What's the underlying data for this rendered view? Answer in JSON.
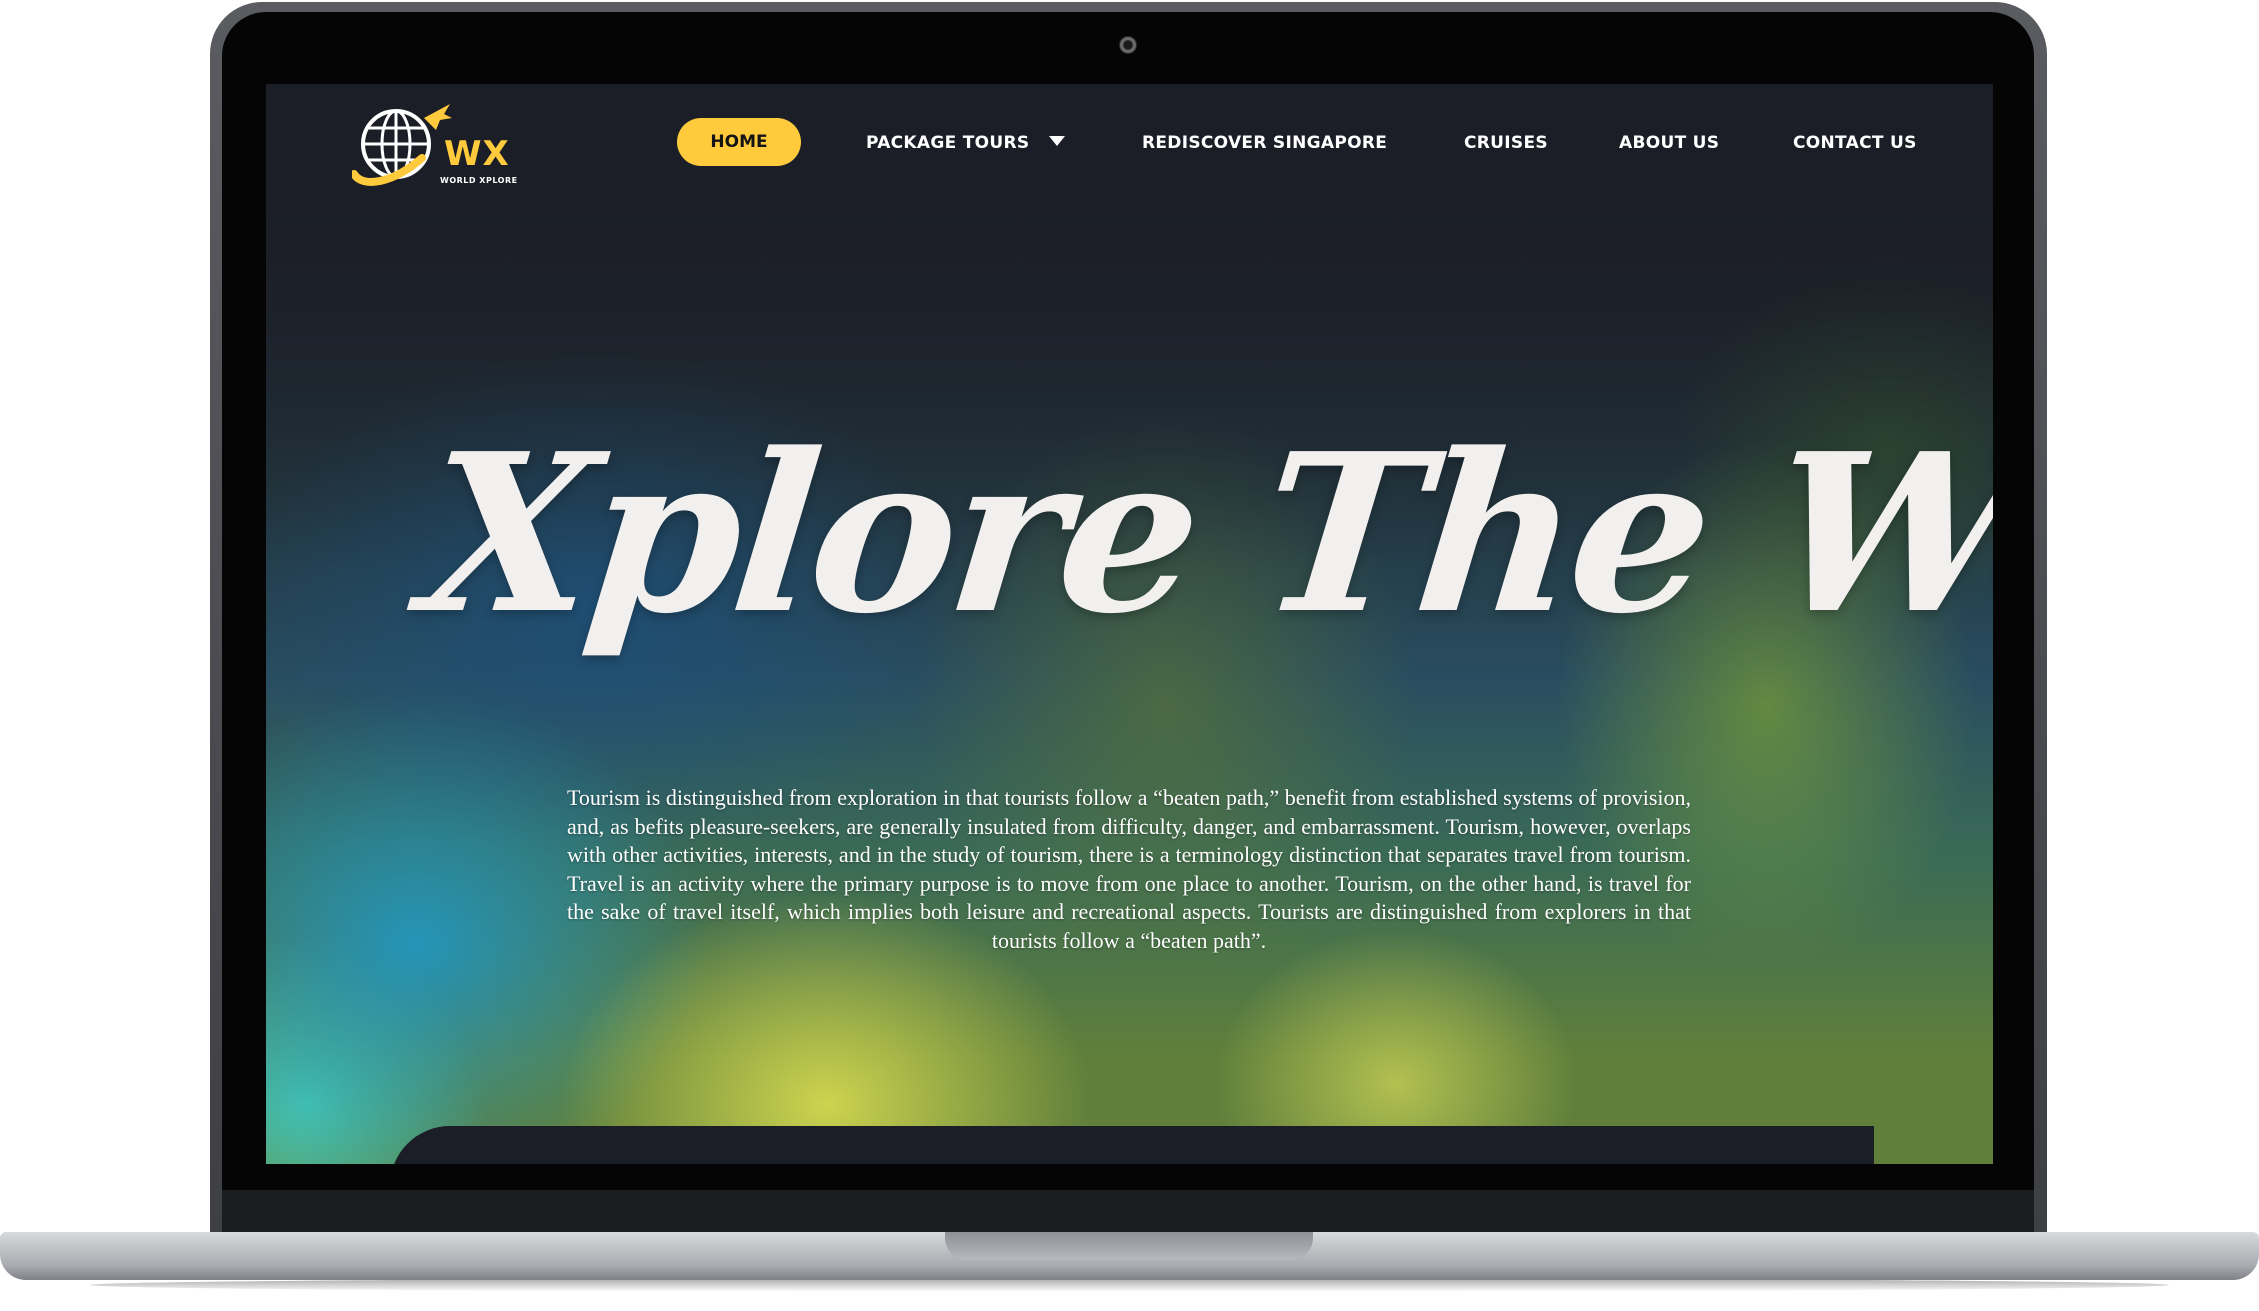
{
  "brand": {
    "logo_text": "WX",
    "logo_subtext": "WORLD XPLORE",
    "accent_color": "#ffcb3c"
  },
  "nav": {
    "home": "HOME",
    "package_tours": "PACKAGE TOURS",
    "rediscover_singapore": "REDISCOVER SINGAPORE",
    "cruises": "CRUISES",
    "about_us": "ABOUT US",
    "contact_us": "CONTACT US"
  },
  "hero": {
    "title": "Xplore The World",
    "paragraph": "Tourism is distinguished from exploration in that tourists follow a “beaten path,” benefit from established systems of provision, and, as befits pleasure-seekers, are generally insulated from difficulty, danger, and embarrassment. Tourism, however, overlaps with other activities, interests, and in the study of tourism, there is a terminology distinction that separates travel from tourism. Travel is an activity where the primary purpose is to move from one place to another. Tourism, on the other hand, is travel for the sake of travel itself, which implies both leisure and recreational aspects. Tourists are distinguished from explorers in that tourists follow a “beaten path”."
  }
}
